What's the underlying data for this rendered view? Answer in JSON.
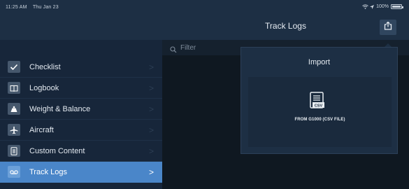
{
  "status_bar": {
    "time": "11:25 AM",
    "date": "Thu Jan 23",
    "battery": "100%",
    "battery_percent": 100
  },
  "nav": {
    "title": "Track Logs",
    "share_icon": "share-icon"
  },
  "sidebar": {
    "items": [
      {
        "label": "Checklist",
        "icon": "checkmark-icon",
        "selected": false
      },
      {
        "label": "Logbook",
        "icon": "book-icon",
        "selected": false
      },
      {
        "label": "Weight & Balance",
        "icon": "scale-icon",
        "selected": false
      },
      {
        "label": "Aircraft",
        "icon": "airplane-icon",
        "selected": false
      },
      {
        "label": "Custom Content",
        "icon": "document-icon",
        "selected": false
      },
      {
        "label": "Track Logs",
        "icon": "track-icon",
        "selected": true
      }
    ],
    "chevron": ">"
  },
  "filter": {
    "placeholder": "Filter",
    "value": ""
  },
  "import_popover": {
    "title": "Import",
    "option_label": "FROM G1000 (CSV FILE)",
    "option_icon": "csv-file-icon",
    "icon_badge": "CSV"
  },
  "colors": {
    "nav_background": "#1d2f44",
    "sidebar_background": "#17263a",
    "selected_accent": "#4a86c9",
    "content_background": "#0f1821"
  }
}
